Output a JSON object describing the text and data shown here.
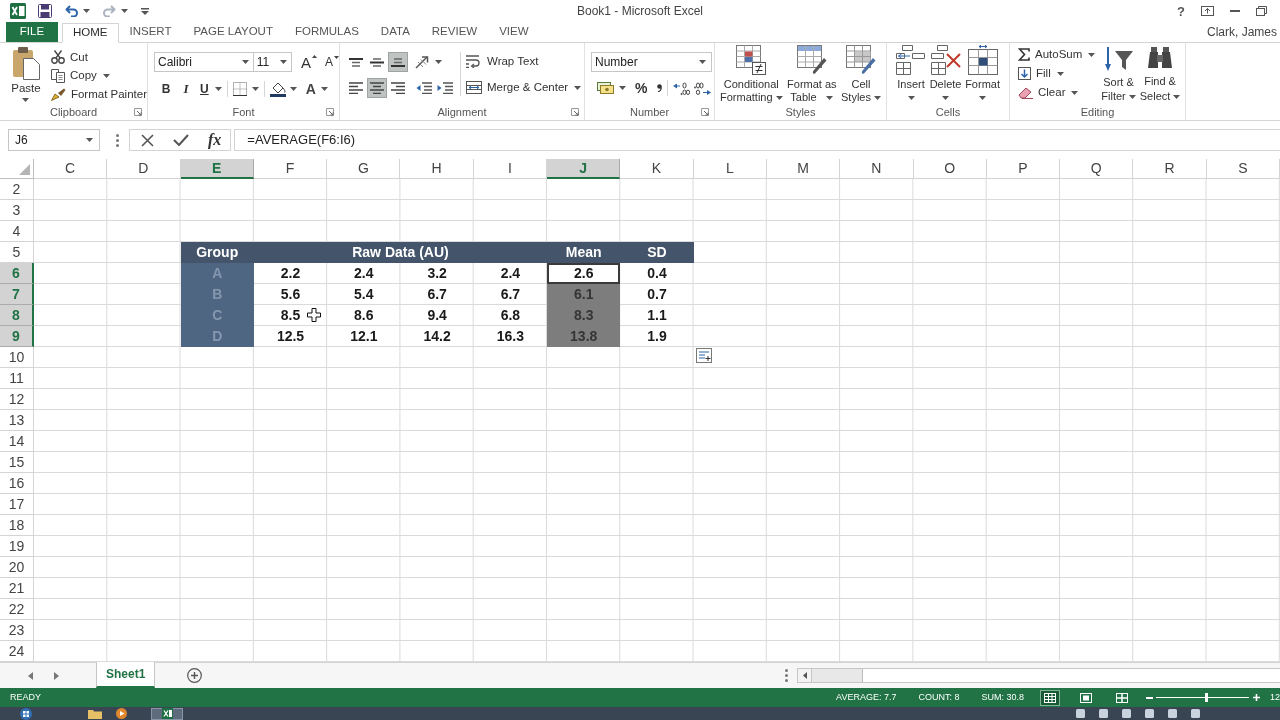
{
  "window": {
    "title": "Book1 - Microsoft Excel",
    "help": "?",
    "user": "Clark, James"
  },
  "quick_access": [
    {
      "kind": "save",
      "disabled": false
    },
    {
      "kind": "undo",
      "disabled": false
    },
    {
      "kind": "redo",
      "disabled": true
    },
    {
      "kind": "customize",
      "disabled": false
    }
  ],
  "tabs": [
    {
      "label": "FILE",
      "kind": "file",
      "selected": false
    },
    {
      "label": "HOME",
      "kind": "tab",
      "selected": true
    },
    {
      "label": "INSERT",
      "kind": "tab",
      "selected": false
    },
    {
      "label": "PAGE LAYOUT",
      "kind": "tab",
      "selected": false
    },
    {
      "label": "FORMULAS",
      "kind": "tab",
      "selected": false
    },
    {
      "label": "DATA",
      "kind": "tab",
      "selected": false
    },
    {
      "label": "REVIEW",
      "kind": "tab",
      "selected": false
    },
    {
      "label": "VIEW",
      "kind": "tab",
      "selected": false
    }
  ],
  "ribbon": {
    "clipboard": {
      "label": "Clipboard",
      "paste": "Paste",
      "cut": "Cut",
      "copy": "Copy",
      "format_painter": "Format Painter"
    },
    "font": {
      "label": "Font",
      "font_name": "Calibri",
      "font_size": "11",
      "grow": "A",
      "shrink": "A",
      "bold": "B",
      "italic": "I",
      "underline": "U",
      "font_color": "A"
    },
    "alignment": {
      "label": "Alignment",
      "vertical": [
        {
          "kind": "top",
          "selected": false
        },
        {
          "kind": "middle",
          "selected": false
        },
        {
          "kind": "bottom",
          "selected": true
        }
      ],
      "horizontal": [
        {
          "kind": "left",
          "selected": false
        },
        {
          "kind": "center",
          "selected": true
        },
        {
          "kind": "right",
          "selected": false
        }
      ],
      "wrap_text": "Wrap Text",
      "merge_center": "Merge & Center"
    },
    "number": {
      "label": "Number",
      "format": "Number",
      "percent": "%"
    },
    "styles": {
      "label": "Styles",
      "buttons": [
        {
          "kind": "conditional",
          "lines": [
            "Conditional",
            "Formatting"
          ]
        },
        {
          "kind": "table",
          "lines": [
            "Format as",
            "Table"
          ]
        },
        {
          "kind": "cell_styles",
          "lines": [
            "Cell",
            "Styles"
          ]
        }
      ]
    },
    "cells": {
      "label": "Cells",
      "buttons": [
        {
          "kind": "insert",
          "label": "Insert"
        },
        {
          "kind": "delete",
          "label": "Delete"
        },
        {
          "kind": "format",
          "label": "Format"
        }
      ]
    },
    "editing": {
      "label": "Editing",
      "autosum": "AutoSum",
      "fill": "Fill",
      "clear": "Clear",
      "sort_filter": [
        "Sort &",
        "Filter"
      ],
      "find_select": [
        "Find &",
        "Select"
      ]
    }
  },
  "formula_bar": {
    "name_box": "J6",
    "insert_function": "fx",
    "formula": "=AVERAGE(F6:I6)"
  },
  "sheet": {
    "columns": [
      {
        "label": "C",
        "selected": false
      },
      {
        "label": "D",
        "selected": false
      },
      {
        "label": "E",
        "selected": true
      },
      {
        "label": "F",
        "selected": false
      },
      {
        "label": "G",
        "selected": false
      },
      {
        "label": "H",
        "selected": false
      },
      {
        "label": "I",
        "selected": false
      },
      {
        "label": "J",
        "selected": true
      },
      {
        "label": "K",
        "selected": false
      },
      {
        "label": "L",
        "selected": false
      },
      {
        "label": "M",
        "selected": false
      },
      {
        "label": "N",
        "selected": false
      },
      {
        "label": "O",
        "selected": false
      },
      {
        "label": "P",
        "selected": false
      },
      {
        "label": "Q",
        "selected": false
      },
      {
        "label": "R",
        "selected": false
      },
      {
        "label": "S",
        "selected": false
      }
    ],
    "rows": [
      {
        "label": "2",
        "selected": false
      },
      {
        "label": "3",
        "selected": false
      },
      {
        "label": "4",
        "selected": false
      },
      {
        "label": "5",
        "selected": false
      },
      {
        "label": "6",
        "selected": true
      },
      {
        "label": "7",
        "selected": true
      },
      {
        "label": "8",
        "selected": true
      },
      {
        "label": "9",
        "selected": true
      },
      {
        "label": "10",
        "selected": false
      },
      {
        "label": "11",
        "selected": false
      },
      {
        "label": "12",
        "selected": false
      },
      {
        "label": "13",
        "selected": false
      },
      {
        "label": "14",
        "selected": false
      },
      {
        "label": "15",
        "selected": false
      },
      {
        "label": "16",
        "selected": false
      },
      {
        "label": "17",
        "selected": false
      },
      {
        "label": "18",
        "selected": false
      },
      {
        "label": "19",
        "selected": false
      },
      {
        "label": "20",
        "selected": false
      },
      {
        "label": "21",
        "selected": false
      },
      {
        "label": "22",
        "selected": false
      },
      {
        "label": "23",
        "selected": false
      },
      {
        "label": "24",
        "selected": false
      }
    ]
  },
  "table": {
    "header": {
      "group": "Group",
      "raw_data": "Raw Data (AU)",
      "mean": "Mean",
      "sd": "SD"
    },
    "rows": [
      {
        "group": {
          "text": "A",
          "selected": true
        },
        "values": [
          "2.2",
          "2.4",
          "3.2",
          "2.4"
        ],
        "mean": {
          "text": "2.6",
          "active": true,
          "selected": false
        },
        "sd": "0.4"
      },
      {
        "group": {
          "text": "B",
          "selected": true
        },
        "values": [
          "5.6",
          "5.4",
          "6.7",
          "6.7"
        ],
        "mean": {
          "text": "6.1",
          "active": false,
          "selected": true
        },
        "sd": "0.7"
      },
      {
        "group": {
          "text": "C",
          "selected": true
        },
        "values": [
          "8.5",
          "8.6",
          "9.4",
          "6.8"
        ],
        "mean": {
          "text": "8.3",
          "active": false,
          "selected": true
        },
        "sd": "1.1"
      },
      {
        "group": {
          "text": "D",
          "selected": true
        },
        "values": [
          "12.5",
          "12.1",
          "14.2",
          "16.3"
        ],
        "mean": {
          "text": "13.8",
          "active": false,
          "selected": true
        },
        "sd": "1.9"
      }
    ]
  },
  "sheet_tabs": [
    {
      "label": "Sheet1",
      "selected": true
    }
  ],
  "status_bar": {
    "mode": "READY",
    "average": "AVERAGE: 7.7",
    "count": "COUNT: 8",
    "sum": "SUM: 30.8",
    "views": [
      {
        "kind": "normal",
        "selected": true
      },
      {
        "kind": "page_layout",
        "selected": false
      },
      {
        "kind": "page_break",
        "selected": false
      }
    ],
    "zoom": {
      "level": 0.54,
      "percent": "12"
    }
  }
}
